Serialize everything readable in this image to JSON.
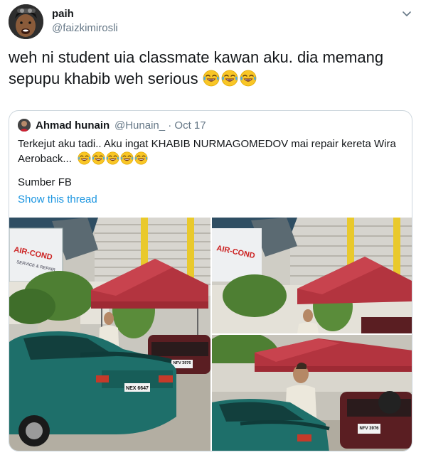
{
  "tweet": {
    "display_name": "paih",
    "handle": "@faizkimirosli",
    "text_line1": "weh ni student uia classmate kawan aku. dia memang",
    "text_line2": "sepupu khabib weh serious",
    "emoji": "face-with-tears-of-joy",
    "emoji_count": 3
  },
  "quoted": {
    "display_name": "Ahmad hunain",
    "handle_date": "@Hunain_ · Oct 17",
    "text_line1": "Terkejut aku tadi.. Aku ingat KHABIB NURMAGOMEDOV mai repair kereta Wira",
    "text_line2": "Aeroback...",
    "emoji_count": 5,
    "source": "Sumber FB",
    "show_thread": "Show this thread",
    "photos": [
      {
        "sign": "AIR-COND SERVICE & REPAIR",
        "plate_front": "NEX 6647",
        "plate_rear": "NFV 3976"
      },
      {
        "sign": "AIR-COND SERVICE & REPAIR"
      },
      {
        "plate_rear": "NFV 3976"
      }
    ]
  },
  "colors": {
    "text": "#14171a",
    "secondary": "#657786",
    "link": "#1b95e0",
    "border": "#ccd6dd",
    "canopy": "#b3343f",
    "car": "#1e6f6a"
  }
}
